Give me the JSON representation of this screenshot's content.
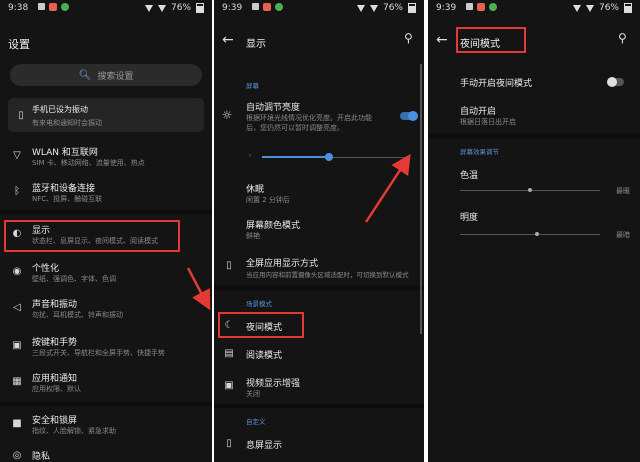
{
  "colors": {
    "accent": "#4a90e2",
    "highlight": "#e53935",
    "panel_bg": "#141414"
  },
  "panel1": {
    "status": {
      "time": "9:38",
      "battery": "76%"
    },
    "title": "设置",
    "search_placeholder": "搜索设置",
    "vibrate_card": {
      "title": "手机已设为振动",
      "sub": "有来电和通知时会振动"
    },
    "items": [
      {
        "title": "WLAN 和互联网",
        "sub": "SIM 卡、移动网络、流量使用、热点",
        "icon": "wifi-icon"
      },
      {
        "title": "蓝牙和设备连接",
        "sub": "NFC、投屏、触碰互联",
        "icon": "bluetooth-icon"
      },
      {
        "title": "显示",
        "sub": "状态栏、息屏显示、夜间模式、阅读模式",
        "icon": "display-icon"
      },
      {
        "title": "个性化",
        "sub": "壁纸、强调色、字体、色调",
        "icon": "palette-icon"
      },
      {
        "title": "声音和振动",
        "sub": "勿扰、耳机模式、铃声和振动",
        "icon": "sound-icon"
      },
      {
        "title": "按键和手势",
        "sub": "三段式开关、导航栏和全屏手势、快捷手势",
        "icon": "gesture-icon"
      },
      {
        "title": "应用和通知",
        "sub": "应用权限、默认",
        "icon": "apps-icon"
      },
      {
        "title": "安全和锁屏",
        "sub": "指纹、人脸解锁、紧急求助",
        "icon": "lock-icon"
      },
      {
        "title": "隐私",
        "sub": "",
        "icon": "privacy-icon"
      }
    ]
  },
  "panel2": {
    "status": {
      "time": "9:39",
      "battery": "76%"
    },
    "title": "显示",
    "section_screen": "屏幕",
    "auto_brightness": {
      "title": "自动调节亮度",
      "sub1": "根据环境光线情况优化亮度。开启此功能",
      "sub2": "后，您仍然可以暂时调整亮度。"
    },
    "brightness_level": 0.45,
    "sleep": {
      "title": "休眠",
      "sub": "闲置 2 分钟后"
    },
    "color_mode": {
      "title": "屏幕颜色模式",
      "sub": "鲜艳"
    },
    "fullscreen": {
      "title": "全屏应用显示方式",
      "sub": "当应用内容和前置摄像头区域适配时，可切换到默认模式"
    },
    "section_scene": "场景模式",
    "night_mode": {
      "title": "夜间模式"
    },
    "reading_mode": {
      "title": "阅读模式"
    },
    "video_enhance": {
      "title": "视频显示增强",
      "sub": "关闭"
    },
    "section_custom": "自定义",
    "ambient": {
      "title": "息屏显示"
    }
  },
  "panel3": {
    "status": {
      "time": "9:39",
      "battery": "76%"
    },
    "title": "夜间模式",
    "manual": {
      "title": "手动开启夜间模式"
    },
    "auto_on": {
      "title": "自动开启",
      "sub": "根据日落日出开启"
    },
    "section_effect": "屏幕效果调节",
    "color_temp": {
      "title": "色温",
      "label_right": "最暖",
      "level": 0.5
    },
    "brightness": {
      "title": "明度",
      "label_right": "最暗",
      "level": 0.55
    }
  }
}
